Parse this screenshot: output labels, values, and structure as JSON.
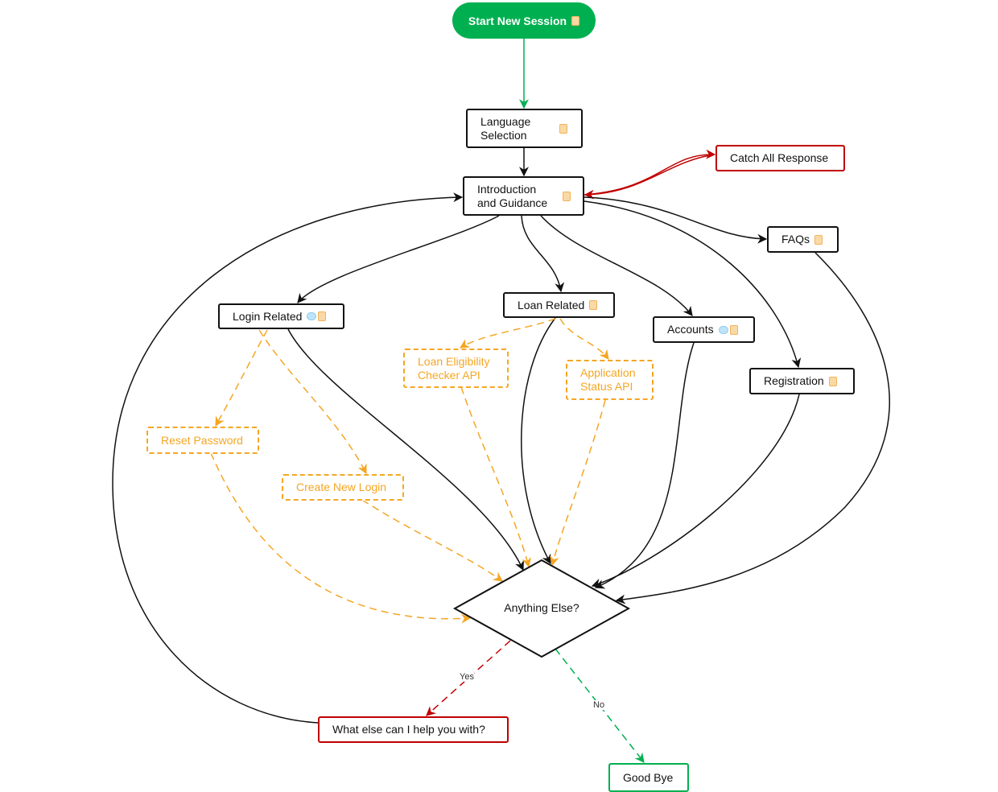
{
  "start": {
    "label": "Start New Session",
    "icon": "note-icon"
  },
  "nodes": {
    "language": {
      "label": "Language Selection"
    },
    "intro": {
      "label": "Introduction and Guidance"
    },
    "catch_all": {
      "label": "Catch All Response"
    },
    "faqs": {
      "label": "FAQs"
    },
    "login": {
      "label": "Login Related"
    },
    "loan": {
      "label": "Loan Related"
    },
    "accounts": {
      "label": "Accounts"
    },
    "registration": {
      "label": "Registration"
    },
    "loan_eligibility": {
      "label": "Loan Eligibility Checker API"
    },
    "application_status": {
      "label": "Application Status API"
    },
    "reset_password": {
      "label": "Reset Password"
    },
    "create_login": {
      "label": "Create New Login"
    },
    "anything_else": {
      "label": "Anything Else?"
    },
    "what_else": {
      "label": "What else can I help you with?"
    },
    "good_bye": {
      "label": "Good Bye"
    }
  },
  "edge_labels": {
    "yes": "Yes",
    "no": "No"
  },
  "colors": {
    "green": "#00b050",
    "red": "#c00000",
    "orange": "#f5a623",
    "black": "#111111"
  }
}
